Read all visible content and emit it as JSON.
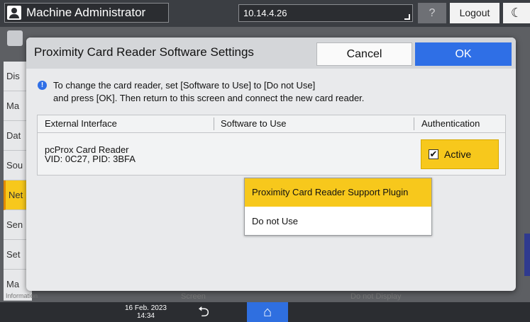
{
  "topbar": {
    "user_name": "Machine Administrator",
    "ip_address": "10.14.4.26",
    "help_label": "?",
    "logout_label": "Logout",
    "sleep_icon": "moon-icon"
  },
  "background": {
    "side_tabs": [
      "Dis",
      "Ma",
      "Dat",
      "Sou",
      "Net",
      "Sen",
      "Set",
      "Ma"
    ],
    "active_side_tab": "Net",
    "bottom_fragments": [
      "Information",
      "Screen",
      "Do not Display"
    ]
  },
  "bottombar": {
    "date": "16 Feb. 2023",
    "time": "14:34",
    "back_icon": "back-arrow-icon",
    "home_icon": "home-icon",
    "home_color": "#2f6fe0"
  },
  "dialog": {
    "title": "Proximity Card Reader Software Settings",
    "cancel_label": "Cancel",
    "ok_label": "OK",
    "info_line1": "To change the card reader, set [Software to Use] to [Do not Use]",
    "info_line2": "and press [OK]. Then return to this screen and connect the new card reader.",
    "table": {
      "headers": [
        "External Interface",
        "Software to Use",
        "Authentication"
      ],
      "row": {
        "device_name": "pcProx Card Reader",
        "device_id": "VID: 0C27, PID: 3BFA",
        "auth_label": "Active",
        "auth_checked": true
      }
    },
    "software_options": [
      "Proximity Card Reader Support Plugin",
      "Do not Use"
    ],
    "selected_option": "Proximity Card Reader Support Plugin",
    "accent_color": "#f7c81c",
    "ok_color": "#2f6fe6"
  }
}
